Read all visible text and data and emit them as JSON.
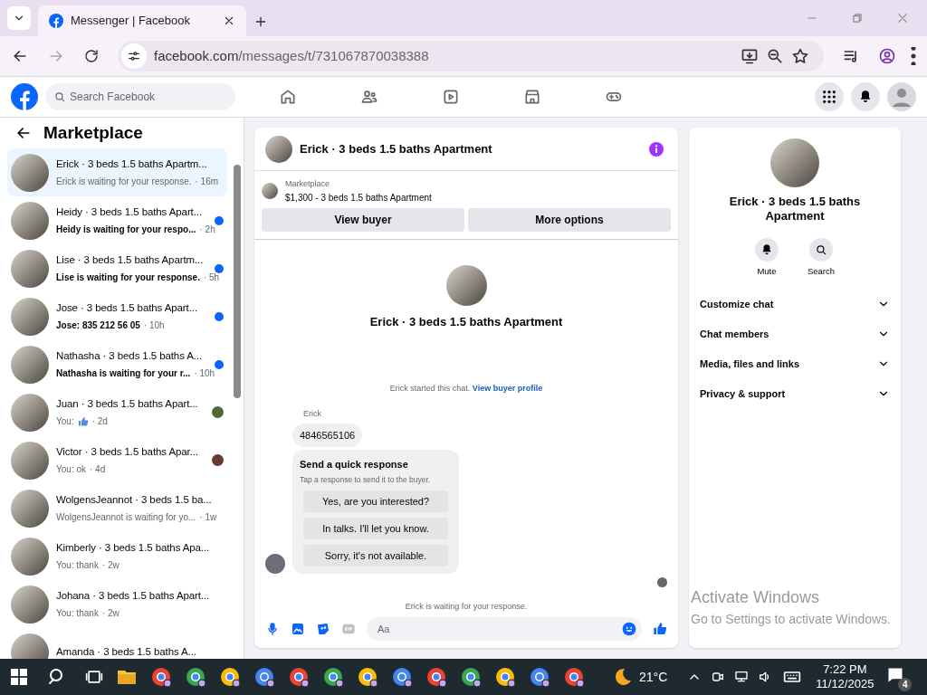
{
  "browser": {
    "tab_title": "Messenger | Facebook",
    "url_host": "facebook.com",
    "url_path": "/messages/t/731067870038388"
  },
  "header": {
    "search_placeholder": "Search Facebook"
  },
  "sidebar": {
    "title": "Marketplace",
    "conversations": [
      {
        "name": "Erick · 3 beds 1.5 baths Apartm...",
        "preview": "Erick is waiting for your response.",
        "time": "· 16m",
        "selected": true,
        "unread": false,
        "liked": false
      },
      {
        "name": "Heidy · 3 beds 1.5 baths Apart...",
        "preview": "Heidy is waiting for your respo...",
        "time": "· 2h",
        "selected": false,
        "unread": true,
        "liked": false
      },
      {
        "name": "Lise · 3 beds 1.5 baths Apartm...",
        "preview": "Lise is waiting for your response.",
        "time": "· 5h",
        "selected": false,
        "unread": true,
        "liked": false
      },
      {
        "name": "Jose · 3 beds 1.5 baths Apart...",
        "preview": "Jose: 835 212 56 05",
        "time": "· 10h",
        "selected": false,
        "unread": true,
        "liked": false
      },
      {
        "name": "Nathasha · 3 beds 1.5 baths A...",
        "preview": "Nathasha is waiting for your r...",
        "time": "· 10h",
        "selected": false,
        "unread": true,
        "liked": false
      },
      {
        "name": "Juan · 3 beds 1.5 baths Apart...",
        "preview": "You:",
        "time": "· 2d",
        "selected": false,
        "unread": false,
        "liked": true,
        "color": "#4a6a3a"
      },
      {
        "name": "Victor · 3 beds 1.5 baths Apar...",
        "preview": "You: ok",
        "time": "· 4d",
        "selected": false,
        "unread": false,
        "liked": false,
        "color": "#6a3a2a"
      },
      {
        "name": "WolgensJeannot · 3 beds 1.5 ba...",
        "preview": "WolgensJeannot is waiting for yo...",
        "time": "· 1w",
        "selected": false,
        "unread": false,
        "liked": false
      },
      {
        "name": "Kimberly · 3 beds 1.5 baths Apa...",
        "preview": "You: thank",
        "time": "· 2w",
        "selected": false,
        "unread": false,
        "liked": false
      },
      {
        "name": "Johana · 3 beds 1.5 baths Apart...",
        "preview": "You: thank",
        "time": "· 2w",
        "selected": false,
        "unread": false,
        "liked": false
      },
      {
        "name": "Amanda · 3 beds 1.5 baths A...",
        "selected": false
      }
    ]
  },
  "chat": {
    "title": "Erick · 3 beds 1.5 baths Apartment",
    "listing_source": "Marketplace",
    "listing": "$1,300 - 3 beds 1.5 baths Apartment",
    "buttons": [
      "View buyer",
      "More options"
    ],
    "intro_title": "Erick · 3 beds 1.5 baths Apartment",
    "started": "Erick started this chat.",
    "started_link": "View buyer profile",
    "sender": "Erick",
    "message": "4846565106",
    "quick_title": "Send a quick response",
    "quick_hint": "Tap a response to send it to the buyer.",
    "quick_responses": [
      "Yes, are you interested?",
      "In talks. I'll let you know.",
      "Sorry, it's not available."
    ],
    "waiting": "Erick is waiting for your response.",
    "composer_placeholder": "Aa"
  },
  "details": {
    "title": "Erick · 3 beds 1.5 baths Apartment",
    "actions": [
      "Mute",
      "Search"
    ],
    "sections": [
      "Customize chat",
      "Chat members",
      "Media, files and links",
      "Privacy & support"
    ]
  },
  "activation": {
    "title": "Activate Windows",
    "subtitle": "Go to Settings to activate Windows."
  },
  "taskbar": {
    "weather": "21°C",
    "time": "7:22 PM",
    "date": "11/12/2025",
    "notifications": "4"
  }
}
